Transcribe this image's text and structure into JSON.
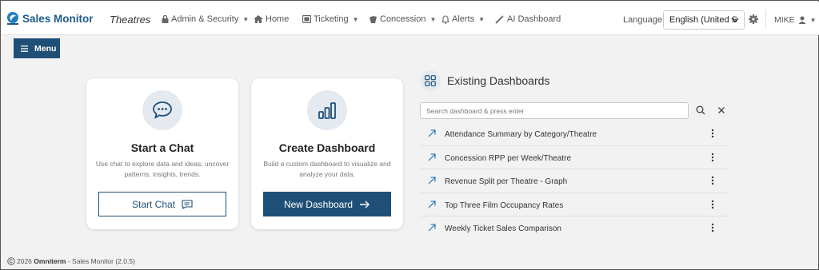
{
  "app": {
    "title": "Sales Monitor",
    "section": "Theatres"
  },
  "nav": {
    "items": [
      {
        "label": "Admin & Security",
        "icon": "lock-icon",
        "caret": true
      },
      {
        "label": "Home",
        "icon": "home-icon",
        "caret": false
      },
      {
        "label": "Ticketing",
        "icon": "ticket-icon",
        "caret": true
      },
      {
        "label": "Concession",
        "icon": "popcorn-icon",
        "caret": true
      },
      {
        "label": "Alerts",
        "icon": "bell-icon",
        "caret": true
      },
      {
        "label": "AI Dashboard",
        "icon": "magic-wand-icon",
        "caret": false
      }
    ],
    "language_label": "Language:",
    "language_value": "English (United S",
    "user": "MIKE"
  },
  "menu_button": "Menu",
  "chat_card": {
    "title": "Start a Chat",
    "description": "Use chat to explore data and ideas; uncover patterns, insights, trends.",
    "button": "Start Chat"
  },
  "dashboard_card": {
    "title": "Create Dashboard",
    "description": "Build a custom dashboard to visualize and analyze your data.",
    "button": "New Dashboard"
  },
  "existing": {
    "title": "Existing Dashboards",
    "search_placeholder": "Search dashboard & press enter",
    "items": [
      "Attendance Summary by Category/Theatre",
      "Concession RPP per Week/Theatre",
      "Revenue Split per Theatre - Graph",
      "Top Three Film Occupancy Rates",
      "Weekly Ticket Sales Comparison"
    ]
  },
  "footer": {
    "year": "2026",
    "company": "Omniterm",
    "product": "- Sales Monitor (2.0.5)"
  },
  "colors": {
    "brand": "#1f4f77",
    "logo_blue": "#1f5b8a",
    "accent_bg": "#e4eaf0"
  }
}
